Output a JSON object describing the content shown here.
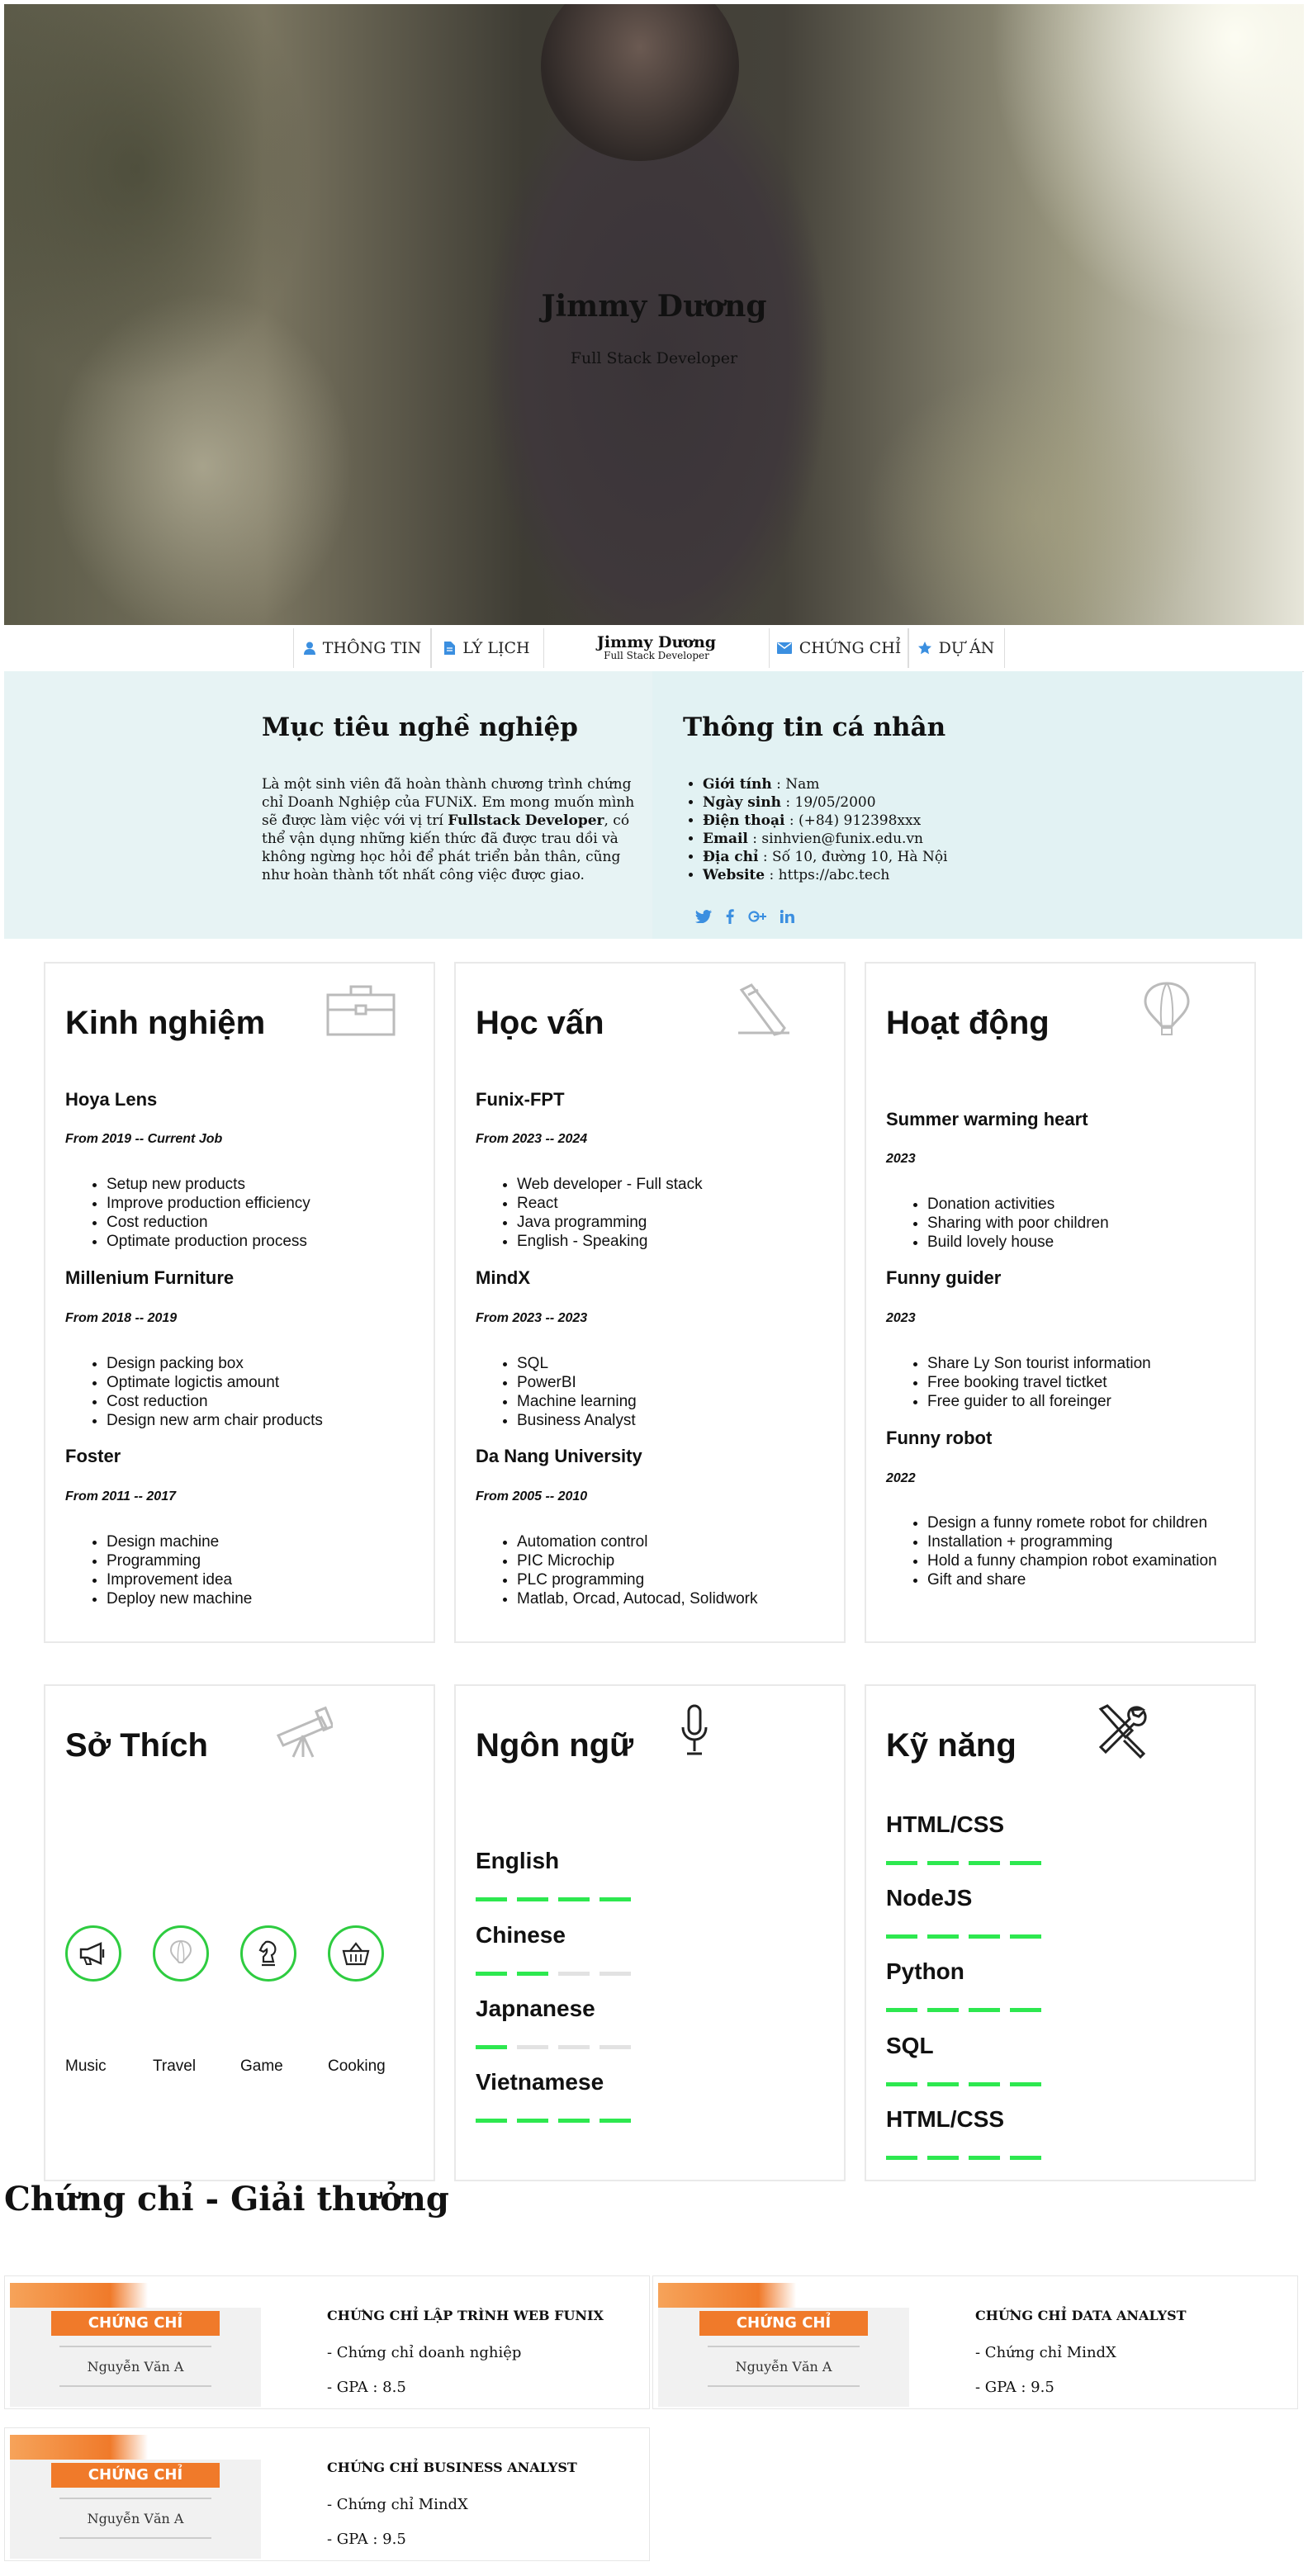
{
  "hero": {
    "name": "Jimmy Dương",
    "role": "Full Stack Developer"
  },
  "nav": {
    "items": [
      {
        "label": "THÔNG TIN",
        "icon": "user-icon"
      },
      {
        "label": "LÝ LỊCH",
        "icon": "document-icon"
      },
      {
        "label": "CHỨNG CHỈ",
        "icon": "envelope-icon"
      },
      {
        "label": "DỰ ÁN",
        "icon": "star-icon"
      }
    ],
    "center_name": "Jimmy Dương",
    "center_role": "Full Stack Developer",
    "icon_color": "#3b8fe0"
  },
  "objective": {
    "title": "Mục tiêu nghề nghiệp",
    "text_before": "Là một sinh viên đã hoàn thành chương trình chứng chỉ Doanh Nghiệp của FUNiX. Em mong muốn mình sẽ được làm việc với vị trí ",
    "highlight": "Fullstack Developer",
    "text_after": ", có thể vận dụng những kiến thức đã được trau dồi và không ngừng học hỏi để phát triển bản thân, cũng như hoàn thành tốt nhất công việc được giao."
  },
  "personal": {
    "title": "Thông tin cá nhân",
    "items": [
      {
        "label": "Giới tính",
        "value": " : Nam"
      },
      {
        "label": "Ngày sinh",
        "value": " : 19/05/2000"
      },
      {
        "label": "Điện thoại",
        "value": " : (+84) 912398xxx"
      },
      {
        "label": "Email",
        "value": " : sinhvien@funix.edu.vn"
      },
      {
        "label": "Địa chỉ",
        "value": " : Số 10, đường 10, Hà Nội"
      },
      {
        "label": "Website",
        "value": " : https://abc.tech"
      }
    ],
    "social": [
      "twitter-icon",
      "facebook-icon",
      "google-plus-icon",
      "linkedin-icon"
    ]
  },
  "experience": {
    "title": "Kinh nghiệm",
    "entries": [
      {
        "title": "Hoya Lens",
        "date": "From 2019 -- Current Job",
        "items": [
          "Setup new products",
          "Improve production efficiency",
          "Cost reduction",
          "Optimate production process"
        ]
      },
      {
        "title": "Millenium Furniture",
        "date": "From 2018 -- 2019",
        "items": [
          "Design packing box",
          "Optimate logictis amount",
          "Cost reduction",
          "Design new arm chair products"
        ]
      },
      {
        "title": "Foster",
        "date": "From 2011 -- 2017",
        "items": [
          "Design machine",
          "Programming",
          "Improvement idea",
          "Deploy new machine"
        ]
      }
    ]
  },
  "education": {
    "title": "Học vấn",
    "entries": [
      {
        "title": "Funix-FPT",
        "date": "From 2023 -- 2024",
        "items": [
          "Web developer - Full stack",
          "React",
          "Java programming",
          "English - Speaking"
        ]
      },
      {
        "title": "MindX",
        "date": "From 2023 -- 2023",
        "items": [
          "SQL",
          "PowerBI",
          "Machine learning",
          "Business Analyst"
        ]
      },
      {
        "title": "Da Nang University",
        "date": "From 2005 -- 2010",
        "items": [
          "Automation control",
          "PIC Microchip",
          "PLC programming",
          "Matlab, Orcad, Autocad, Solidwork"
        ]
      }
    ]
  },
  "activities": {
    "title": "Hoạt động",
    "entries": [
      {
        "title": "Summer warming heart",
        "date": "2023",
        "items": [
          "Donation activities",
          "Sharing with poor children",
          "Build lovely house"
        ]
      },
      {
        "title": "Funny guider",
        "date": "2023",
        "items": [
          "Share Ly Son tourist information",
          "Free booking travel tictket",
          "Free guider to all foreinger"
        ]
      },
      {
        "title": "Funny robot",
        "date": "2022",
        "items": [
          "Design a funny romete robot for children",
          "Installation + programming",
          "Hold a funny champion robot examination",
          "Gift and share"
        ]
      }
    ]
  },
  "hobbies": {
    "title": "Sở Thích",
    "items": [
      {
        "label": "Music",
        "icon": "megaphone-icon"
      },
      {
        "label": "Travel",
        "icon": "balloon-icon"
      },
      {
        "label": "Game",
        "icon": "chess-knight-icon"
      },
      {
        "label": "Cooking",
        "icon": "basket-icon"
      }
    ],
    "accent": "#2ecc40"
  },
  "languages": {
    "title": "Ngôn ngữ",
    "items": [
      {
        "label": "English",
        "level": 4
      },
      {
        "label": "Chinese",
        "level": 2
      },
      {
        "label": "Japnanese",
        "level": 1
      },
      {
        "label": "Vietnamese",
        "level": 4
      }
    ],
    "max_level": 4,
    "bar_color": "#2de84f"
  },
  "skills": {
    "title": "Kỹ năng",
    "items": [
      {
        "label": "HTML/CSS",
        "level": 4
      },
      {
        "label": "NodeJS",
        "level": 4
      },
      {
        "label": "Python",
        "level": 4
      },
      {
        "label": "SQL",
        "level": 4
      },
      {
        "label": "HTML/CSS",
        "level": 4
      }
    ],
    "max_level": 4
  },
  "certificates": {
    "title": "Chứng chỉ - Giải thưởng",
    "image_banner": "CHỨNG CHỈ",
    "image_name": "Nguyễn Văn A",
    "items": [
      {
        "name": "CHỨNG CHỈ LẬP TRÌNH WEB FUNIX",
        "line1": "- Chứng chỉ doanh nghiệp",
        "line2": "- GPA : 8.5"
      },
      {
        "name": "CHỨNG CHỈ DATA ANALYST",
        "line1": "- Chứng chỉ MindX",
        "line2": "- GPA : 9.5"
      },
      {
        "name": "CHỨNG CHỈ BUSINESS ANALYST",
        "line1": "- Chứng chỉ MindX",
        "line2": "- GPA : 9.5"
      }
    ]
  }
}
